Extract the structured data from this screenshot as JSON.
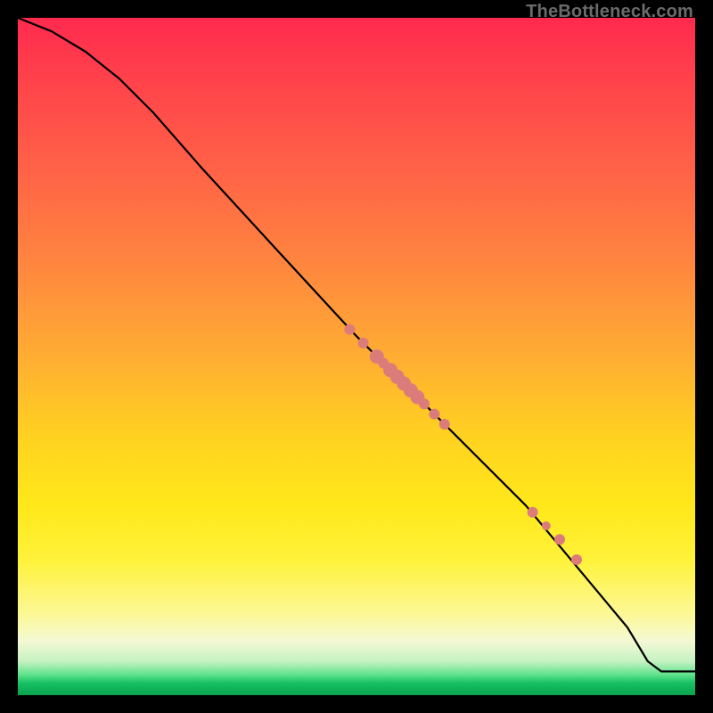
{
  "site": {
    "watermark": "TheBottleneck.com"
  },
  "chart_data": {
    "type": "line",
    "title": "",
    "xlabel": "",
    "ylabel": "",
    "xlim": [
      0,
      100
    ],
    "ylim": [
      0,
      100
    ],
    "grid": false,
    "series": [
      {
        "name": "curve",
        "type": "line",
        "color": "#000000",
        "x": [
          0,
          5,
          10,
          15,
          20,
          27,
          38,
          50,
          55,
          60,
          65,
          70,
          75,
          80,
          85,
          90,
          93,
          95,
          100
        ],
        "y": [
          100,
          98,
          95,
          91,
          86,
          78,
          66,
          53,
          48,
          43,
          38,
          33,
          28,
          22,
          16,
          10,
          5,
          3.5,
          3.5
        ]
      },
      {
        "name": "highlighted-points",
        "type": "scatter",
        "color": "#db7c7a",
        "radius_default": 6,
        "points": [
          {
            "x": 49,
            "y": 54,
            "r": 6
          },
          {
            "x": 51,
            "y": 52,
            "r": 6
          },
          {
            "x": 53,
            "y": 50,
            "r": 8
          },
          {
            "x": 54,
            "y": 49,
            "r": 6
          },
          {
            "x": 55,
            "y": 48,
            "r": 8
          },
          {
            "x": 56,
            "y": 47,
            "r": 8
          },
          {
            "x": 57,
            "y": 46,
            "r": 8
          },
          {
            "x": 58,
            "y": 45,
            "r": 8
          },
          {
            "x": 59,
            "y": 44,
            "r": 8
          },
          {
            "x": 60,
            "y": 43,
            "r": 6
          },
          {
            "x": 61.5,
            "y": 41.5,
            "r": 6
          },
          {
            "x": 63,
            "y": 40,
            "r": 6
          },
          {
            "x": 76,
            "y": 27,
            "r": 6
          },
          {
            "x": 78,
            "y": 25,
            "r": 5
          },
          {
            "x": 80,
            "y": 23,
            "r": 6
          },
          {
            "x": 82.5,
            "y": 20,
            "r": 6
          }
        ]
      }
    ]
  }
}
